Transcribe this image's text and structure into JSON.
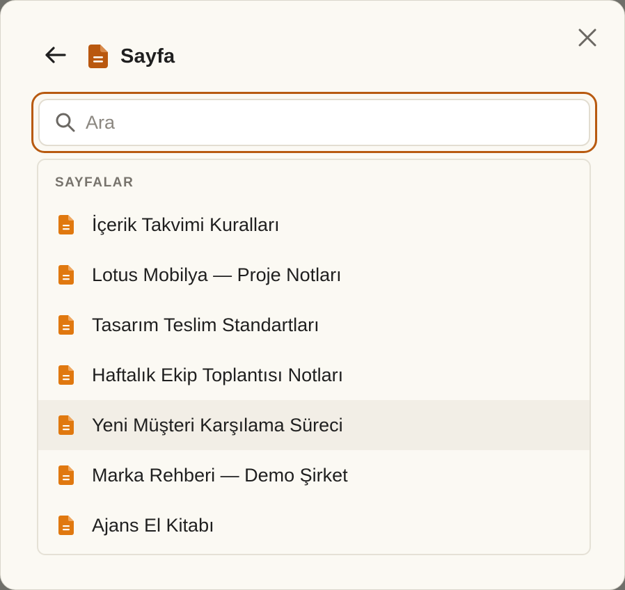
{
  "header": {
    "title": "Sayfa",
    "back_icon": "arrow-left-icon",
    "title_icon": "document-icon",
    "close_icon": "close-icon"
  },
  "search": {
    "placeholder": "Ara",
    "value": "",
    "icon": "search-icon"
  },
  "pages_section": {
    "label": "SAYFALAR",
    "items": [
      {
        "label": "İçerik Takvimi Kuralları",
        "icon": "document-icon",
        "highlighted": false
      },
      {
        "label": "Lotus Mobilya — Proje Notları",
        "icon": "document-icon",
        "highlighted": false
      },
      {
        "label": "Tasarım Teslim Standartları",
        "icon": "document-icon",
        "highlighted": false
      },
      {
        "label": "Haftalık Ekip Toplantısı Notları",
        "icon": "document-icon",
        "highlighted": false
      },
      {
        "label": "Yeni Müşteri Karşılama Süreci",
        "icon": "document-icon",
        "highlighted": true
      },
      {
        "label": "Marka Rehberi — Demo Şirket",
        "icon": "document-icon",
        "highlighted": false
      },
      {
        "label": "Ajans El Kitabı",
        "icon": "document-icon",
        "highlighted": false
      }
    ]
  },
  "colors": {
    "accent": "#b85a10",
    "title_icon": "#b9580f",
    "item_icon": "#e0780f",
    "background": "#fbf9f3",
    "highlight_row": "#f2eee6"
  }
}
